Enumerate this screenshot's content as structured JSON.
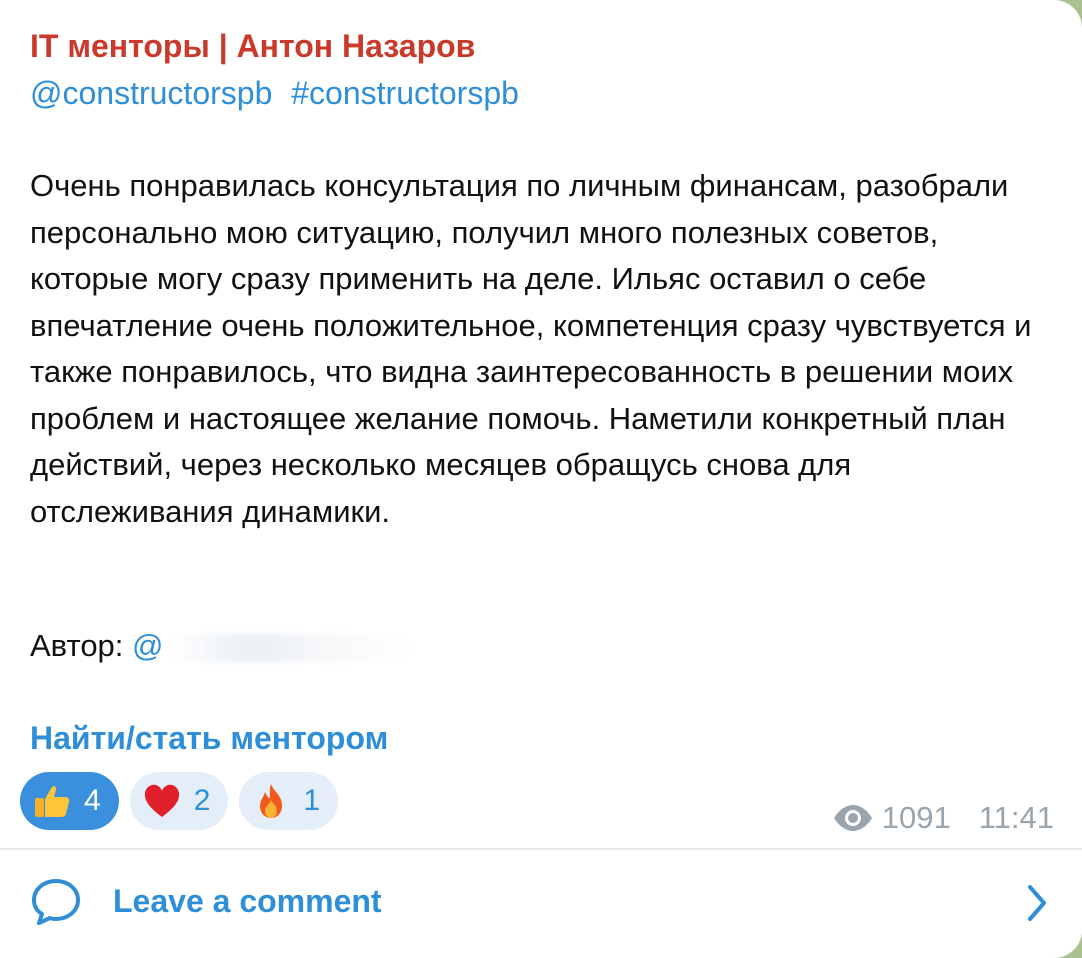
{
  "post": {
    "channel_name": "IT менторы | Антон Назаров",
    "tags": [
      "@constructorspb",
      "#constructorspb"
    ],
    "body": "Очень понравилась консультация по личным финансам, разобрали персонально мою ситуацию, получил много полезных советов, которые могу сразу применить на деле. Ильяс оставил о себе впечатление очень положительное, компетенция сразу чувствуется и также понравилось, что видна заинтересованность в решении моих проблем и настоящее желание помочь. Наметили конкретный план действий, через несколько месяцев обращусь снова для отслеживания динамики.",
    "author_label": "Автор:",
    "author_handle": "@",
    "link_text": "Найти/стать ментором"
  },
  "reactions": [
    {
      "emoji": "thumbs-up",
      "count": "4",
      "active": true
    },
    {
      "emoji": "heart",
      "count": "2",
      "active": false
    },
    {
      "emoji": "fire",
      "count": "1",
      "active": false
    }
  ],
  "meta": {
    "views": "1091",
    "time": "11:41"
  },
  "comment": {
    "label": "Leave a comment"
  },
  "colors": {
    "channel": "#c93a2a",
    "link": "#2f8ed8",
    "reaction_active": "#3a90dd",
    "reaction_inactive": "#e3eef9"
  }
}
